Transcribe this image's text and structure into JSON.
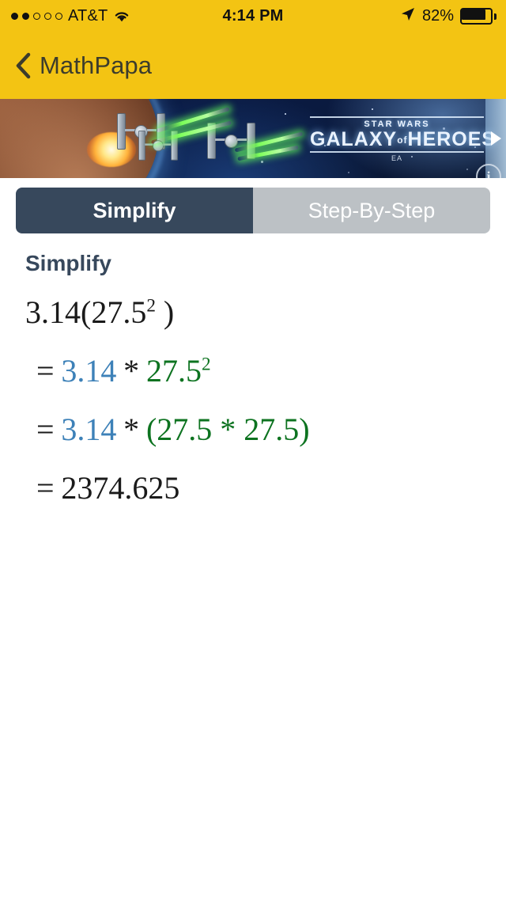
{
  "status_bar": {
    "carrier": "AT&T",
    "signal_dots_total": 5,
    "signal_dots_filled": 2,
    "wifi_icon": "wifi-icon",
    "time": "4:14 PM",
    "location_icon": "location-arrow-icon",
    "battery_percent": "82%",
    "battery_level": 82
  },
  "nav_bar": {
    "back_icon": "chevron-left-icon",
    "title": "MathPapa",
    "background_color": "#f3c413",
    "title_color": "#3c3c2c"
  },
  "ad": {
    "brand_top": "STAR WARS",
    "brand_main": "GALAXY",
    "brand_of": "of",
    "brand_main2": "HEROES",
    "brand_sub": "EA",
    "info_badge": "i",
    "next_arrow_icon": "chevron-right-icon"
  },
  "segmented_control": {
    "tabs": [
      {
        "label": "Simplify",
        "active": true
      },
      {
        "label": "Step-By-Step",
        "active": false
      }
    ],
    "active_color": "#37485c",
    "inactive_color": "#bcc1c5"
  },
  "main": {
    "section_title": "Simplify",
    "expression": {
      "base": "3.14(27.5",
      "exponent": "2",
      "close": " )"
    },
    "steps": [
      {
        "equals": "=",
        "parts": [
          {
            "text": "3.14",
            "color": "#3d81b8"
          },
          {
            "text": "*",
            "color": "#1a1a1a"
          },
          {
            "text": "27.5",
            "color": "#0d7320"
          }
        ],
        "exponent": "2",
        "display": "= 3.14 * 27.5^2"
      },
      {
        "equals": "=",
        "parts": [
          {
            "text": "3.14",
            "color": "#3d81b8"
          },
          {
            "text": "*",
            "color": "#1a1a1a"
          },
          {
            "text": "(27.5 * 27.5)",
            "color": "#0d7320"
          }
        ],
        "display": "= 3.14 * (27.5 * 27.5)"
      },
      {
        "equals": "=",
        "parts": [
          {
            "text": "2374.625",
            "color": "#1a1a1a"
          }
        ],
        "display": "= 2374.625"
      }
    ],
    "result": "2374.625"
  },
  "colors": {
    "accent_yellow": "#f3c413",
    "dark_slate": "#37485c",
    "blue": "#3d81b8",
    "green": "#0d7320"
  }
}
